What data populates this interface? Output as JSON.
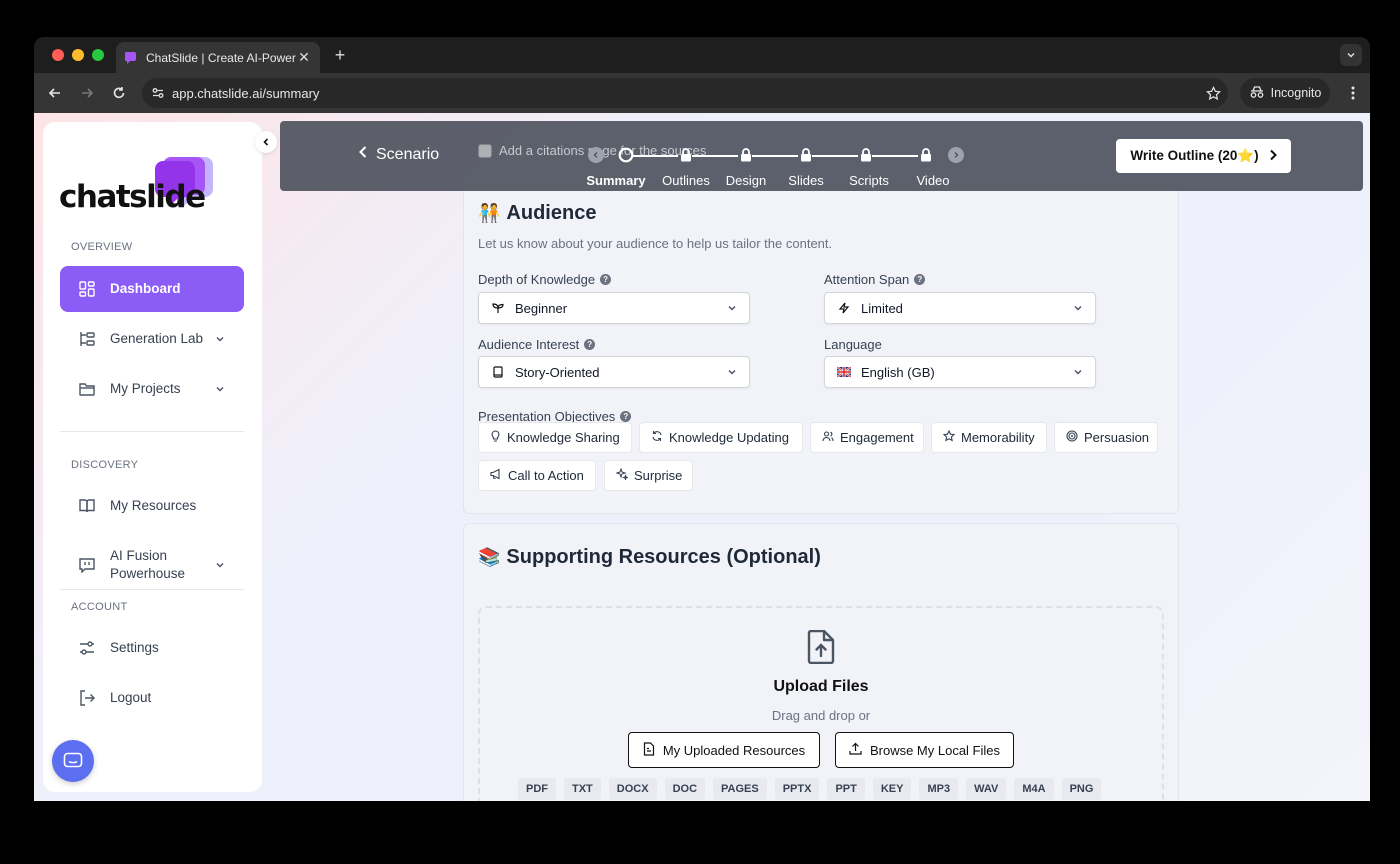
{
  "browser": {
    "tab_title": "ChatSlide | Create AI-Powere",
    "url": "app.chatslide.ai/summary",
    "incognito_label": "Incognito"
  },
  "sidebar": {
    "logo_text": "chatslide",
    "overview_label": "OVERVIEW",
    "discovery_label": "DISCOVERY",
    "account_label": "ACCOUNT",
    "items": [
      {
        "label": "Dashboard"
      },
      {
        "label": "Generation Lab"
      },
      {
        "label": "My Projects"
      },
      {
        "label": "My Resources"
      },
      {
        "label": "AI Fusion Powerhouse"
      },
      {
        "label": "Settings"
      },
      {
        "label": "Logout"
      }
    ]
  },
  "header": {
    "back_label": "Scenario",
    "citations_label": "Add a citations page for the sources",
    "steps": [
      {
        "label": "Summary"
      },
      {
        "label": "Outlines"
      },
      {
        "label": "Design"
      },
      {
        "label": "Slides"
      },
      {
        "label": "Scripts"
      },
      {
        "label": "Video"
      }
    ],
    "write_button": "Write Outline (20⭐)"
  },
  "audience": {
    "emoji": "🧑‍🤝‍🧑",
    "title": "Audience",
    "subtitle": "Let us know about your audience to help us tailor the content.",
    "depth_label": "Depth of Knowledge",
    "depth_value": "Beginner",
    "attention_label": "Attention Span",
    "attention_value": "Limited",
    "interest_label": "Audience Interest",
    "interest_value": "Story-Oriented",
    "language_label": "Language",
    "language_value": "English (GB)",
    "objectives_label": "Presentation Objectives",
    "objectives": [
      {
        "label": "Knowledge Sharing"
      },
      {
        "label": "Knowledge Updating"
      },
      {
        "label": "Engagement"
      },
      {
        "label": "Memorability"
      },
      {
        "label": "Persuasion"
      },
      {
        "label": "Call to Action"
      },
      {
        "label": "Surprise"
      }
    ]
  },
  "resources": {
    "emoji": "📚",
    "title": "Supporting Resources (Optional)",
    "upload_title": "Upload Files",
    "upload_sub": "Drag and drop or",
    "uploaded_btn": "My Uploaded Resources",
    "browse_btn": "Browse My Local Files",
    "file_types": [
      "PDF",
      "TXT",
      "DOCX",
      "DOC",
      "PAGES",
      "PPTX",
      "PPT",
      "KEY",
      "MP3",
      "WAV",
      "M4A",
      "PNG"
    ]
  },
  "colors": {
    "accent": "#8b5cf6",
    "chat_bubble": "#5b6ff0"
  }
}
